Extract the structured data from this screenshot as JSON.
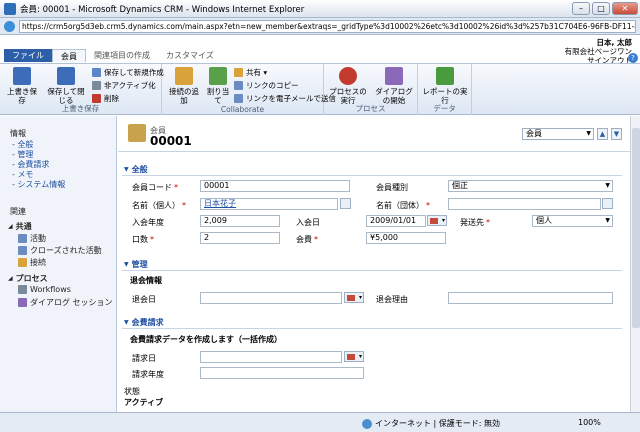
{
  "window": {
    "title": "会員: 00001 - Microsoft Dynamics CRM - Windows Internet Explorer",
    "minimize": "–",
    "maximize": "□",
    "close": "✕"
  },
  "address": {
    "url": "https://crm5org5d3eb.crm5.dynamics.com/main.aspx?etn=new_member&extraqs=_gridType%3d10002%26etc%3d10002%26id%3d%257b31C704E6-96FB-DF11-8D2B-D8D"
  },
  "ribbon_tabs": [
    "ファイル",
    "会員",
    "関連項目の作成",
    "カスタマイズ"
  ],
  "user": {
    "name": "日本, 太郎",
    "org": "有限会社ベージワン",
    "signout": "サインアウト",
    "help": "?"
  },
  "ribbon": {
    "save_group": {
      "label": "上書き保存",
      "save": "上書き保存",
      "save_close": "保存して閉じる",
      "save_new": "保存して新規作成",
      "deactivate": "非アクティブ化",
      "delete": "削除"
    },
    "collab_group": {
      "label": "Collaborate",
      "add_connection": "接続の追加",
      "assign": "割り当て",
      "share": "共有 ▾",
      "copy_link": "リンクのコピー",
      "email_link": "リンクを電子メールで送信"
    },
    "process_group": {
      "label": "プロセス",
      "run_process": "プロセスの実行",
      "start_dialog": "ダイアログの開始"
    },
    "data_group": {
      "label": "データ",
      "run_report": "レポートの実行"
    }
  },
  "nav": {
    "info_head": "情報",
    "info_items": [
      "全般",
      "管理",
      "会費請求",
      "メモ",
      "システム情報"
    ],
    "related_head": "関連",
    "common_head": "共通",
    "common_items": [
      "活動",
      "クローズされた活動",
      "接続"
    ],
    "process_head": "プロセス",
    "process_items": [
      "Workflows",
      "ダイアログ セッション"
    ]
  },
  "header": {
    "entity": "会員",
    "record_name": "00001",
    "form_selector": "会員"
  },
  "form": {
    "general": {
      "title": "全般",
      "member_code_label": "会員コード",
      "member_code": "00001",
      "member_type_label": "会員種別",
      "member_type": "個正",
      "name_personal_label": "名前（個人）",
      "name_personal": "日本花子",
      "name_group_label": "名前（団体）",
      "name_group": "",
      "join_year_label": "入会年度",
      "join_year": "2,009",
      "join_date_label": "入会日",
      "join_date": "2009/01/01",
      "send_to_label": "発送先",
      "send_to": "個人",
      "units_label": "口数",
      "units": "2",
      "fee_label": "会費",
      "fee": "¥5,000"
    },
    "admin": {
      "title": "管理",
      "subhead": "退会情報",
      "leave_date_label": "退会日",
      "leave_date": "",
      "leave_reason_label": "退会理由",
      "leave_reason": ""
    },
    "billing": {
      "title": "会費請求",
      "subhead": "会費請求データを作成します（一括作成）",
      "bill_date_label": "請求日",
      "bill_date": "",
      "bill_year_label": "請求年度",
      "bill_year": ""
    },
    "footer": {
      "status_label": "状態",
      "status_value": "アクティブ"
    }
  },
  "statusbar": {
    "zone": "インターネット | 保護モード: 無効",
    "zoom": "100%"
  }
}
